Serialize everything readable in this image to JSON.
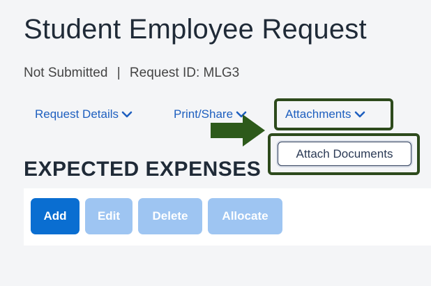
{
  "page": {
    "title": "Student Employee Request",
    "status": "Not Submitted",
    "separator": "|",
    "request_id": "Request ID: MLG3"
  },
  "menu": {
    "request_details": "Request Details",
    "print_share": "Print/Share",
    "attachments": "Attachments"
  },
  "dropdown": {
    "attach_documents": "Attach Documents"
  },
  "expenses": {
    "heading": "EXPECTED EXPENSES",
    "buttons": {
      "add": "Add",
      "edit": "Edit",
      "delete": "Delete",
      "allocate": "Allocate"
    }
  },
  "colors": {
    "link": "#1e5fbf",
    "primary_button": "#0a6ed1",
    "disabled_button": "#9ec5f2",
    "highlight": "#2d4a1c"
  }
}
